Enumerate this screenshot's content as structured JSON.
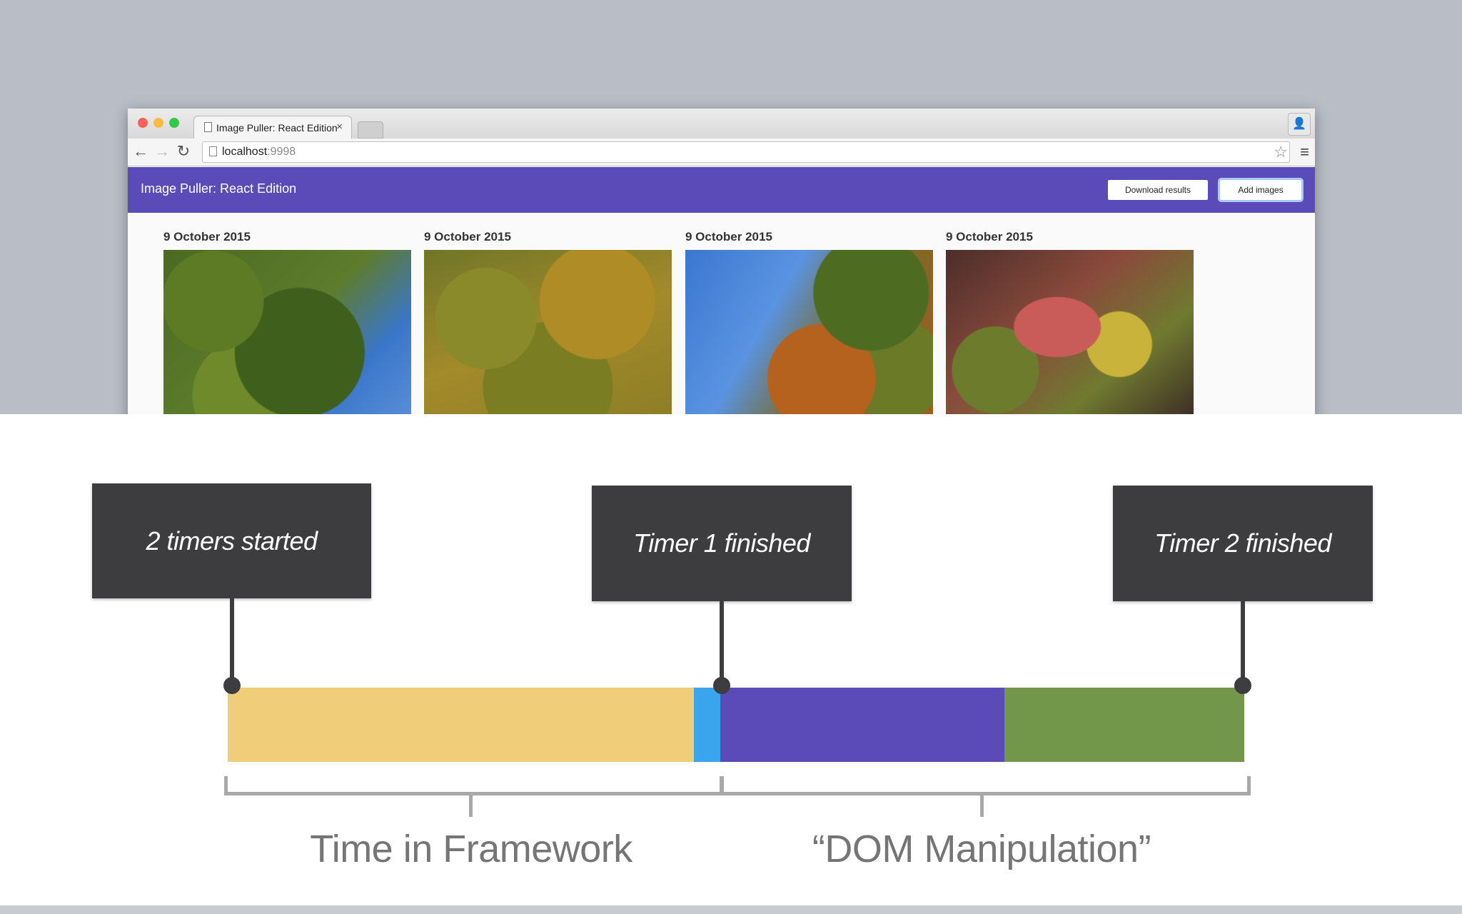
{
  "browser": {
    "tab_title": "Image Puller: React Edition",
    "tab_close": "×",
    "url_host": "localhost",
    "url_port": ":9998"
  },
  "app": {
    "title": "Image Puller: React Edition",
    "download_button": "Download results",
    "add_button": "Add images"
  },
  "gallery": [
    {
      "date": "9 October 2015"
    },
    {
      "date": "9 October 2015"
    },
    {
      "date": "9 October 2015"
    },
    {
      "date": "9 October 2015"
    }
  ],
  "timeline": {
    "callouts": [
      "2 timers started",
      "Timer 1 finished",
      "Timer 2 finished"
    ],
    "segment_colors": [
      "#f0cd79",
      "#3aa4ec",
      "#5b4bb8",
      "#72964a"
    ],
    "labels": [
      "Time in Framework",
      "“DOM Manipulation”"
    ]
  }
}
